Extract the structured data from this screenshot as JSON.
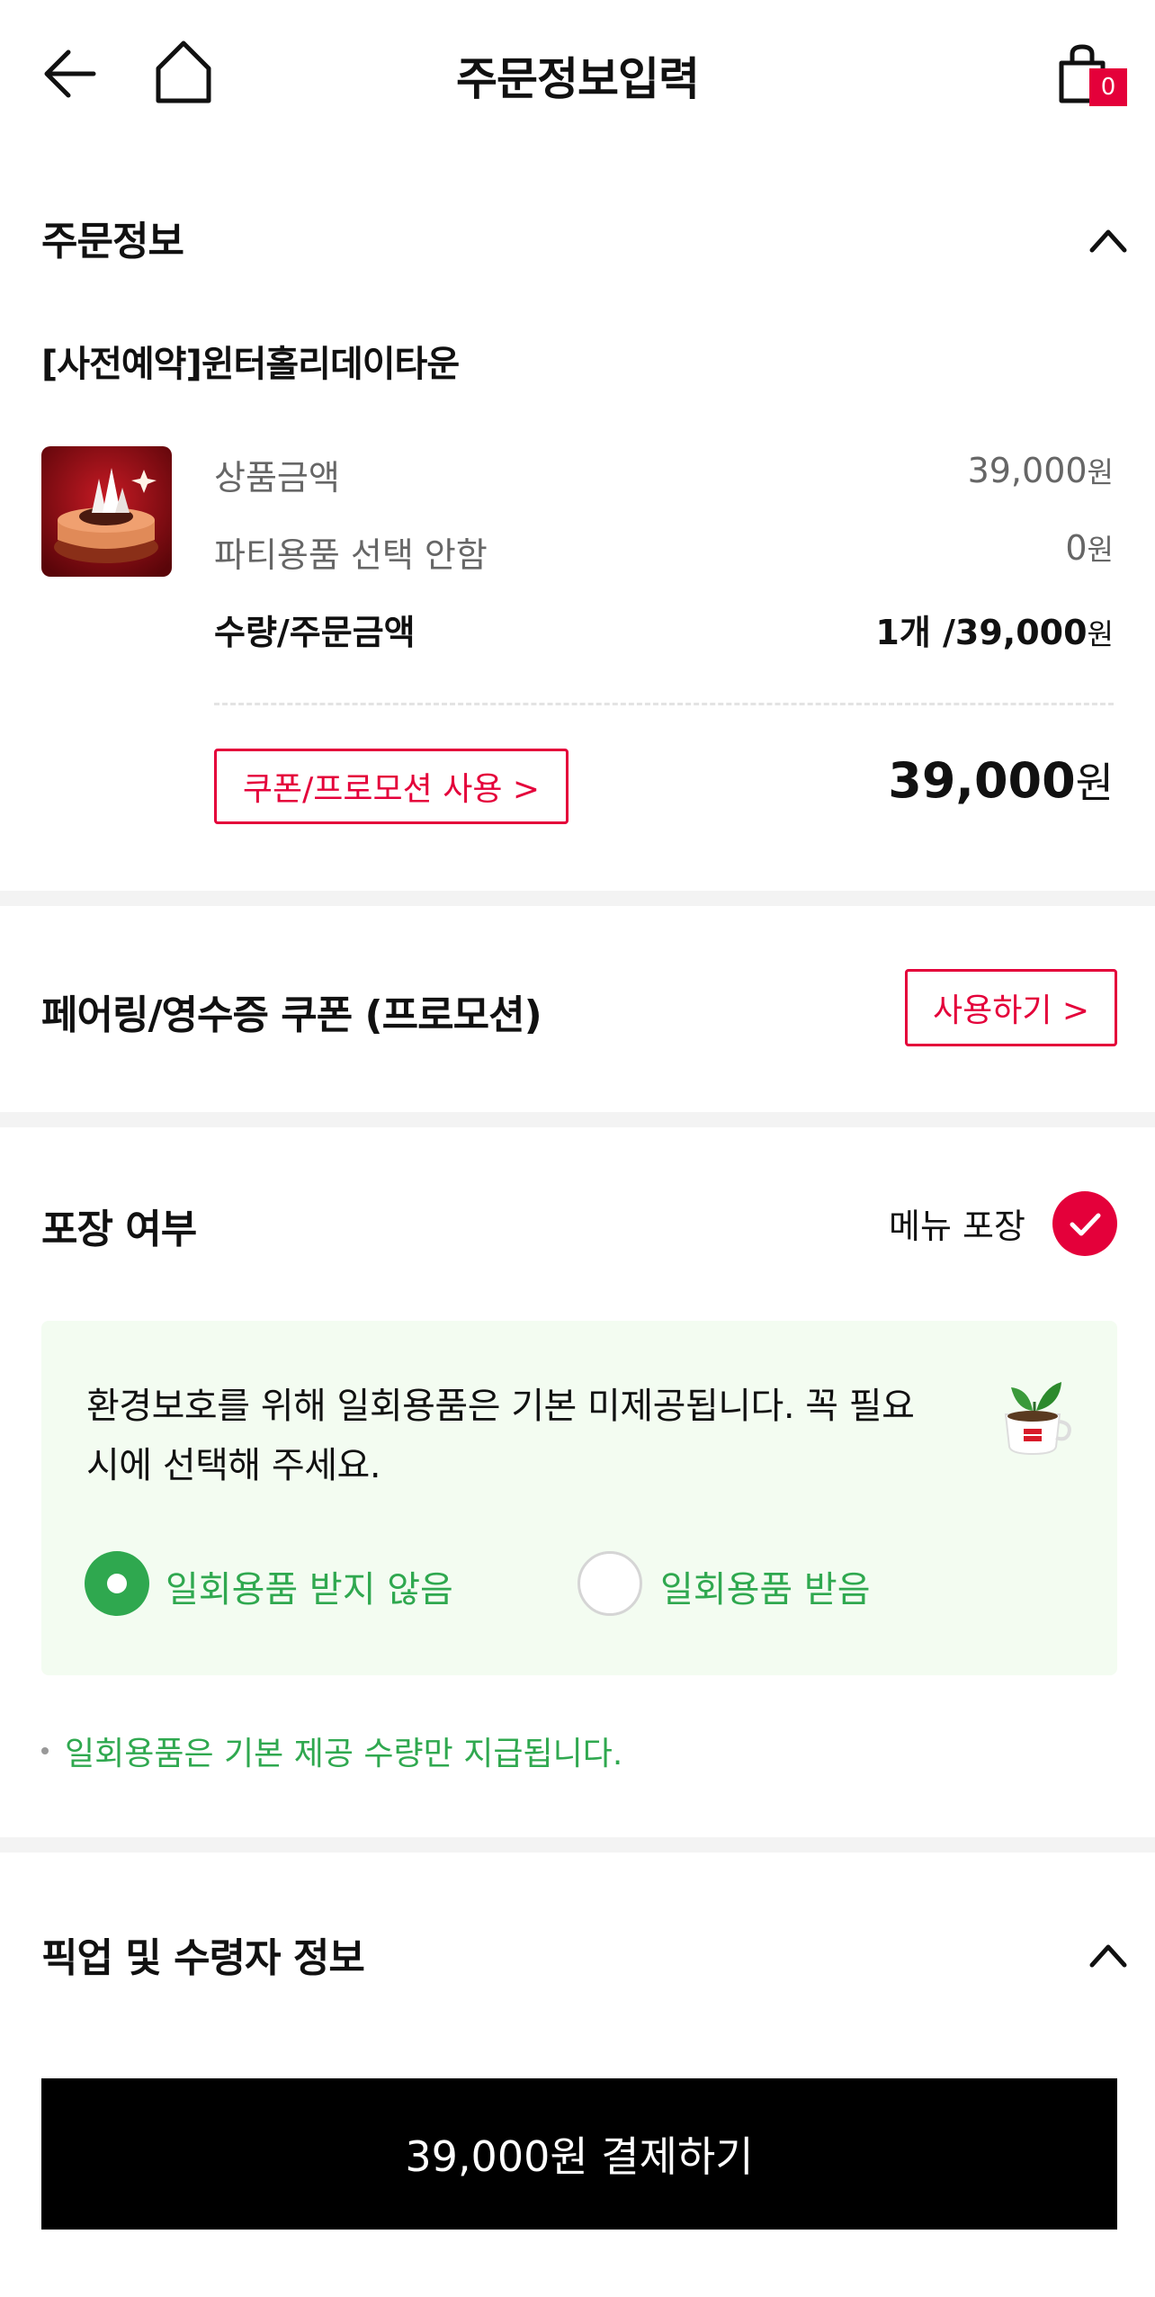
{
  "header": {
    "title": "주문정보입력",
    "cart_count": "0"
  },
  "order_info": {
    "section_title": "주문정보",
    "product_name": "[사전예약]윈터홀리데이타운",
    "rows": [
      {
        "label": "상품금액",
        "value": "39,000",
        "unit": "원"
      },
      {
        "label": "파티용품 선택 안함",
        "value": "0",
        "unit": "원"
      },
      {
        "label": "수량/주문금액",
        "value": "1개 /39,000",
        "unit": "원"
      }
    ],
    "coupon_button": "쿠폰/프로모션 사용 >",
    "total_value": "39,000",
    "total_unit": "원"
  },
  "pairing": {
    "title": "페어링/영수증 쿠폰 (프로모션)",
    "button": "사용하기 >"
  },
  "packaging": {
    "title": "포장 여부",
    "option_label": "메뉴 포장",
    "option_checked": true,
    "eco_message": "환경보호를 위해 일회용품은 기본 미제공됩니다. 꼭 필요시에 선택해 주세요.",
    "radio_options": [
      {
        "label": "일회용품 받지 않음",
        "selected": true
      },
      {
        "label": "일회용품 받음",
        "selected": false
      }
    ],
    "note": "일회용품은 기본 제공 수량만 지급됩니다."
  },
  "pickup": {
    "title": "픽업 및 수령자 정보"
  },
  "pay_button": "39,000원 결제하기",
  "colors": {
    "accent": "#e4003a",
    "green": "#2fa84f",
    "eco_bg": "#f3fcf1",
    "divider": "#f3f3f3"
  },
  "icons": [
    "back-arrow-icon",
    "home-icon",
    "shopping-bag-icon",
    "chevron-up-icon",
    "check-icon",
    "coffee-cup-icon"
  ]
}
